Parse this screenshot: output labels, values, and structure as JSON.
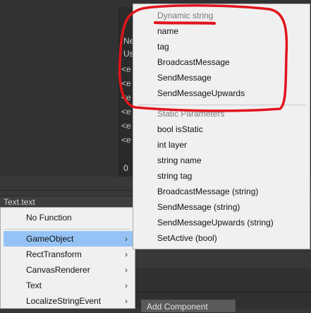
{
  "inspector": {
    "peek_top": [
      "Ne",
      "Us"
    ],
    "peek_rows": [
      "<e",
      "<e",
      "<e",
      "<e",
      "<e",
      "<e"
    ],
    "field_value": "0",
    "header_label": "Text.text",
    "add_component_label": "Add Component"
  },
  "left_menu": {
    "items": [
      {
        "label": "No Function",
        "arrow": ""
      },
      {
        "label": "GameObject",
        "arrow": "›"
      },
      {
        "label": "RectTransform",
        "arrow": "›"
      },
      {
        "label": "CanvasRenderer",
        "arrow": "›"
      },
      {
        "label": "Text",
        "arrow": "›"
      },
      {
        "label": "LocalizeStringEvent",
        "arrow": "›"
      }
    ]
  },
  "right_menu": {
    "dynamic_header": "Dynamic string",
    "dynamic_items": [
      "name",
      "tag",
      "BroadcastMessage",
      "SendMessage",
      "SendMessageUpwards"
    ],
    "static_header": "Static Parameters",
    "static_items": [
      "bool isStatic",
      "int layer",
      "string name",
      "string tag",
      "BroadcastMessage (string)",
      "SendMessage (string)",
      "SendMessageUpwards (string)",
      "SetActive (bool)"
    ]
  },
  "colors": {
    "annotation": "#e0141c",
    "selection": "#96c3f5",
    "menu_bg": "#f0f0f0"
  }
}
